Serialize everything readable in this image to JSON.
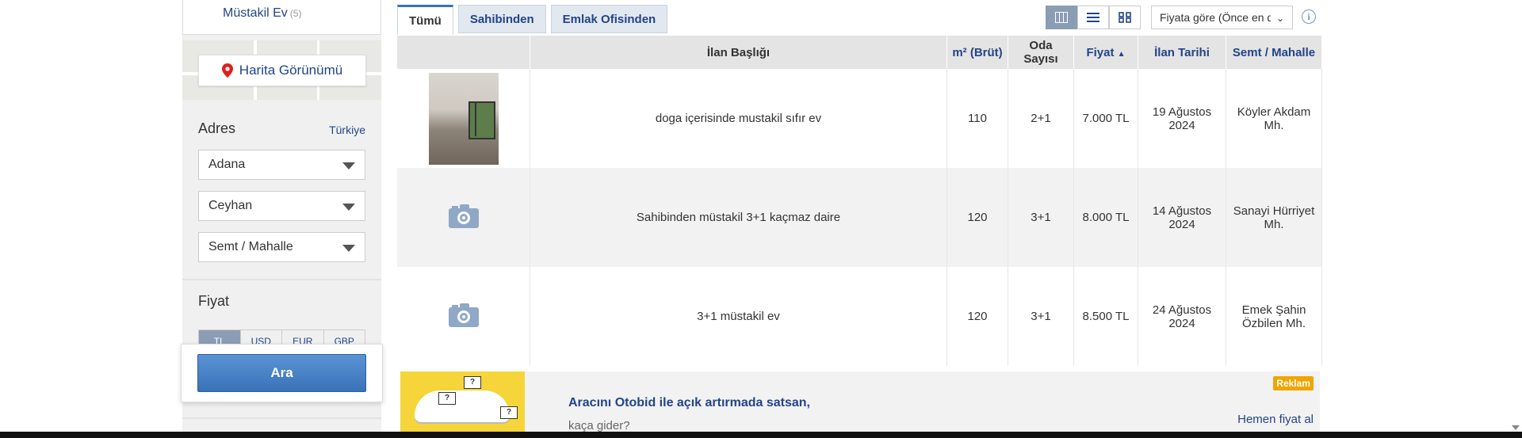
{
  "sidebar": {
    "category": {
      "label": "Müstakil Ev",
      "count": "(5)"
    },
    "map_button": "Harita Görünümü",
    "adres": {
      "title": "Adres",
      "link": "Türkiye"
    },
    "selects": [
      {
        "value": "Adana"
      },
      {
        "value": "Ceyhan"
      },
      {
        "value": "Semt / Mahalle"
      }
    ],
    "fiyat": {
      "title": "Fiyat",
      "currencies": [
        "TL",
        "USD",
        "EUR",
        "GBP"
      ],
      "active_currency": "TL"
    },
    "search_button": "Ara"
  },
  "tabs": [
    {
      "label": "Tümü",
      "active": true
    },
    {
      "label": "Sahibinden",
      "active": false
    },
    {
      "label": "Emlak Ofisinden",
      "active": false
    }
  ],
  "view_modes": [
    {
      "icon": "columns-icon",
      "active": true
    },
    {
      "icon": "list-icon",
      "active": false
    },
    {
      "icon": "grid-icon",
      "active": false
    }
  ],
  "sort": {
    "value": "Fiyata göre (Önce en düşük)"
  },
  "info_icon": "i",
  "table": {
    "headers": {
      "title": "İlan Başlığı",
      "area": "m² (Brüt)",
      "rooms": "Oda Sayısı",
      "price": "Fiyat",
      "date": "İlan Tarihi",
      "location": "Semt / Mahalle"
    },
    "rows": [
      {
        "title": "doga içerisinde mustakil sıfır ev",
        "area": "110",
        "rooms": "2+1",
        "price": "7.000 TL",
        "date": "19 Ağustos 2024",
        "location": "Köyler Akdam Mh.",
        "image": "photo"
      },
      {
        "title": "Sahibinden müstakil 3+1 kaçmaz daire",
        "area": "120",
        "rooms": "3+1",
        "price": "8.000 TL",
        "date": "14 Ağustos 2024",
        "location": "Sanayi Hürriyet Mh.",
        "image": "camera-icon"
      },
      {
        "title": "3+1 müstakil ev",
        "area": "120",
        "rooms": "3+1",
        "price": "8.500 TL",
        "date": "24 Ağustos 2024",
        "location": "Emek Şahin Özbilen Mh.",
        "image": "camera-icon"
      }
    ]
  },
  "ad": {
    "title": "Aracını Otobid ile açık artırmada satsan,",
    "subtitle": "kaça gider?",
    "badge": "Reklam",
    "cta": "Hemen fiyat al",
    "tag_text": "?"
  }
}
